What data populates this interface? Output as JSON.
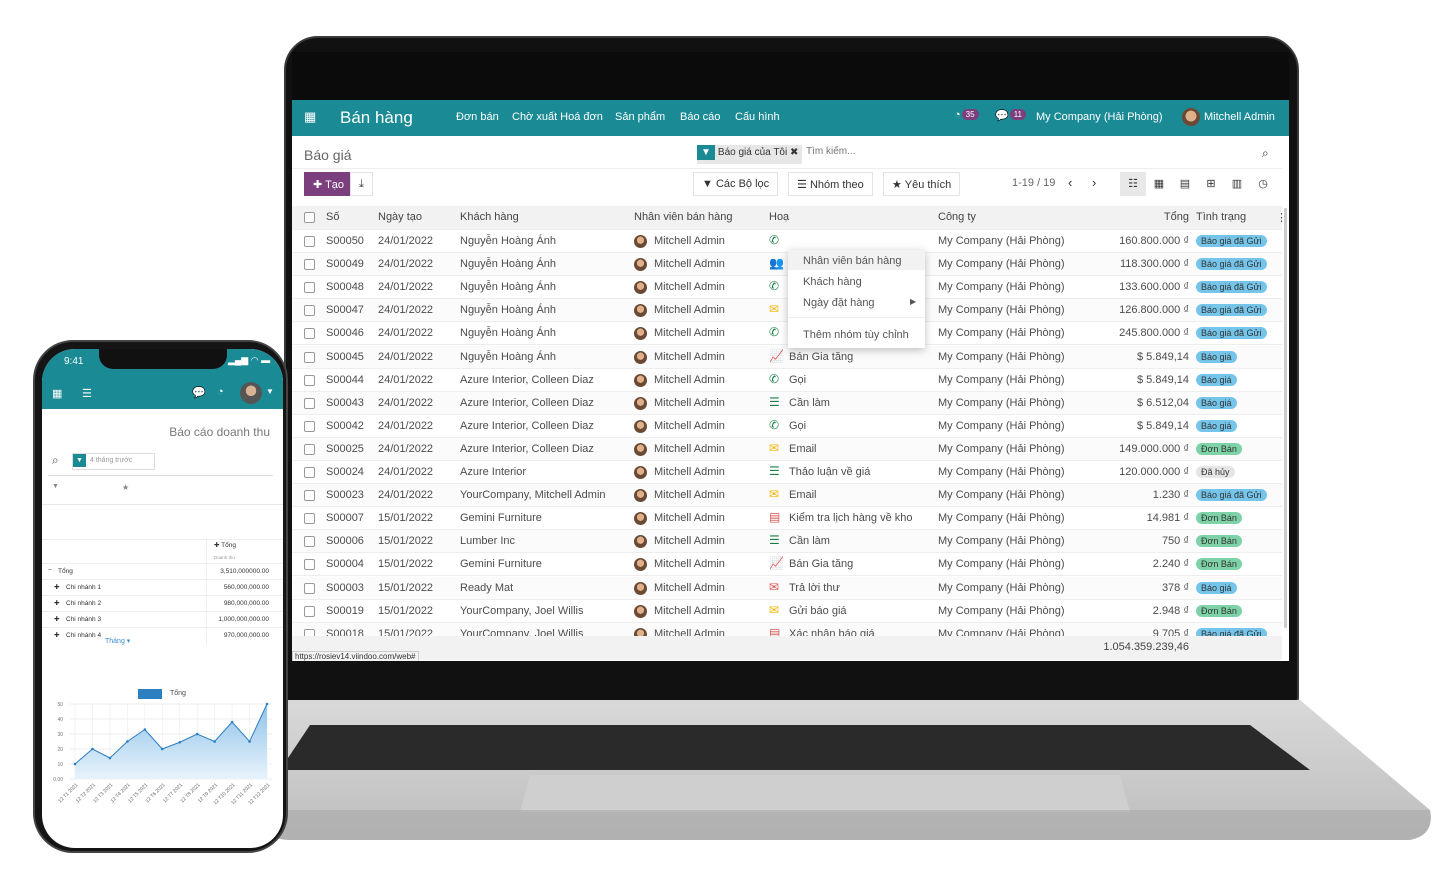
{
  "laptop": {
    "app_title": "Bán hàng",
    "menu": [
      "Đơn bán",
      "Chờ xuất Hoá đơn",
      "Sản phẩm",
      "Báo cáo",
      "Cấu hình"
    ],
    "activity_count": "35",
    "message_count": "11",
    "company": "My Company (Hải Phòng)",
    "user": "Mitchell Admin",
    "breadcrumb": "Báo giá",
    "filter_facet": "Báo giá của Tôi",
    "search_placeholder": "Tìm kiếm...",
    "create_label": "Tạo",
    "filters_label": "Các Bộ lọc",
    "groupby_label": "Nhóm theo",
    "favorites_label": "Yêu thích",
    "pager": "1-19 / 19",
    "groupby_menu": [
      "Nhân viên bán hàng",
      "Khách hàng",
      "Ngày đặt hàng",
      "Thêm nhóm tùy chỉnh"
    ],
    "columns": [
      "Số",
      "Ngày tạo",
      "Khách hàng",
      "Nhân viên bán hàng",
      "Hoạ",
      "Công ty",
      "Tổng",
      "Tình trạng"
    ],
    "rows": [
      [
        "S00050",
        "24/01/2022",
        "Nguyễn Hoàng Ánh",
        "Mitchell Admin",
        "phone",
        "",
        "My Company (Hải Phòng)",
        "160.800.000 ₫",
        "Báo giá đã Gửi"
      ],
      [
        "S00049",
        "24/01/2022",
        "Nguyễn Hoàng Ánh",
        "Mitchell Admin",
        "group",
        "",
        "My Company (Hải Phòng)",
        "118.300.000 ₫",
        "Báo giá đã Gửi"
      ],
      [
        "S00048",
        "24/01/2022",
        "Nguyễn Hoàng Ánh",
        "Mitchell Admin",
        "phone",
        "",
        "My Company (Hải Phòng)",
        "133.600.000 ₫",
        "Báo giá đã Gửi"
      ],
      [
        "S00047",
        "24/01/2022",
        "Nguyễn Hoàng Ánh",
        "Mitchell Admin",
        "email",
        "Email",
        "My Company (Hải Phòng)",
        "126.800.000 ₫",
        "Báo giá đã Gửi"
      ],
      [
        "S00046",
        "24/01/2022",
        "Nguyễn Hoàng Ánh",
        "Mitchell Admin",
        "phone",
        "Gọi",
        "My Company (Hải Phòng)",
        "245.800.000 ₫",
        "Báo giá đã Gửi"
      ],
      [
        "S00045",
        "24/01/2022",
        "Nguyễn Hoàng Ánh",
        "Mitchell Admin",
        "upsell",
        "Bán Gia tăng",
        "My Company (Hải Phòng)",
        "$ 5.849,14",
        "Báo giá"
      ],
      [
        "S00044",
        "24/01/2022",
        "Azure Interior, Colleen Diaz",
        "Mitchell Admin",
        "phone",
        "Gọi",
        "My Company (Hải Phòng)",
        "$ 5.849,14",
        "Báo giá"
      ],
      [
        "S00043",
        "24/01/2022",
        "Azure Interior, Colleen Diaz",
        "Mitchell Admin",
        "todo",
        "Cần làm",
        "My Company (Hải Phòng)",
        "$ 6.512,04",
        "Báo giá"
      ],
      [
        "S00042",
        "24/01/2022",
        "Azure Interior, Colleen Diaz",
        "Mitchell Admin",
        "phone",
        "Gọi",
        "My Company (Hải Phòng)",
        "$ 5.849,14",
        "Báo giá"
      ],
      [
        "S00025",
        "24/01/2022",
        "Azure Interior, Colleen Diaz",
        "Mitchell Admin",
        "email",
        "Email",
        "My Company (Hải Phòng)",
        "149.000.000 ₫",
        "Đơn Bán"
      ],
      [
        "S00024",
        "24/01/2022",
        "Azure Interior",
        "Mitchell Admin",
        "todo",
        "Thảo luận về giá",
        "My Company (Hải Phòng)",
        "120.000.000 ₫",
        "Đã hủy"
      ],
      [
        "S00023",
        "24/01/2022",
        "YourCompany, Mitchell Admin",
        "Mitchell Admin",
        "email",
        "Email",
        "My Company (Hải Phòng)",
        "1.230 ₫",
        "Báo giá đã Gửi"
      ],
      [
        "S00007",
        "15/01/2022",
        "Gemini Furniture",
        "Mitchell Admin",
        "doc-red",
        "Kiểm tra lịch hàng về kho",
        "My Company (Hải Phòng)",
        "14.981 ₫",
        "Đơn Bán"
      ],
      [
        "S00006",
        "15/01/2022",
        "Lumber Inc",
        "Mitchell Admin",
        "todo",
        "Cần làm",
        "My Company (Hải Phòng)",
        "750 ₫",
        "Đơn Bán"
      ],
      [
        "S00004",
        "15/01/2022",
        "Gemini Furniture",
        "Mitchell Admin",
        "upsell-red",
        "Bán Gia tăng",
        "My Company (Hải Phòng)",
        "2.240 ₫",
        "Đơn Bán"
      ],
      [
        "S00003",
        "15/01/2022",
        "Ready Mat",
        "Mitchell Admin",
        "email-red",
        "Trả lời thư",
        "My Company (Hải Phòng)",
        "378 ₫",
        "Báo giá"
      ],
      [
        "S00019",
        "15/01/2022",
        "YourCompany, Joel Willis",
        "Mitchell Admin",
        "email",
        "Gửi báo giá",
        "My Company (Hải Phòng)",
        "2.948 ₫",
        "Đơn Bán"
      ],
      [
        "S00018",
        "15/01/2022",
        "YourCompany, Joel Willis",
        "Mitchell Admin",
        "doc-red",
        "Xác nhận báo giá",
        "My Company (Hải Phòng)",
        "9.705 ₫",
        "Báo giá đã Gửi"
      ]
    ],
    "total": "1.054.359.239,46",
    "status_url": "https://rosiev14.viindoo.com/web#",
    "colors": {
      "brand": "#1a8a95",
      "create": "#7b3f7e",
      "sent": "#75c5ea",
      "sale": "#7dd3a7",
      "cancel": "#e6e6e6"
    }
  },
  "phone": {
    "time": "9:41",
    "title": "Báo cáo doanh thu",
    "filter": "4 tháng trước",
    "col_header": "Tổng",
    "measure": "Doanh thu",
    "rows": [
      [
        "Tổng",
        "3,510,000000.00"
      ],
      [
        "Chi nhánh 1",
        "560,000,000.00"
      ],
      [
        "Chi nhánh 2",
        "980,000,000.00"
      ],
      [
        "Chi nhánh 3",
        "1,000,000,000.00"
      ],
      [
        "Chi nhánh 4",
        "970,000,000.00"
      ]
    ],
    "row_groupby": "Tháng",
    "chart_data": {
      "type": "area",
      "legend": [
        "Tổng"
      ],
      "categories": [
        "12 T1 2021",
        "12 T2 2021",
        "12 T3 2021",
        "12 T4 2021",
        "12 T5 2021",
        "12 T6 2021",
        "12 T7 2021",
        "12 T8 2021",
        "12 T9 2021",
        "12 T10 2021",
        "12 T11 2021",
        "12 T12 2021"
      ],
      "series": [
        {
          "name": "Tổng",
          "values": [
            10,
            20,
            14,
            25,
            33,
            20,
            24.5,
            30,
            25,
            38,
            25,
            50
          ]
        }
      ],
      "yticks": [
        "0.00",
        "10",
        "20",
        "30",
        "40",
        "50"
      ],
      "ylim": [
        0,
        50
      ],
      "grid": true,
      "legend_position": "top",
      "color": "#2c7fc1"
    }
  }
}
